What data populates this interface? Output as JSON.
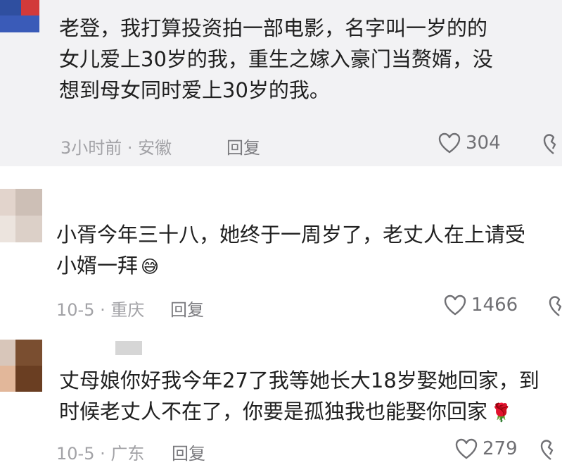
{
  "comments": [
    {
      "lines": [
        "老登，我打算投资拍一部电影，名字叫一岁的的",
        "女儿爱上30岁的我，重生之嫁入豪门当赘婿，没",
        "想到母女同时爱上30岁的我。"
      ],
      "meta": "3小时前 · 安徽",
      "reply_label": "回复",
      "like_count": "304"
    },
    {
      "lines": [
        "小胥今年三十八，她终于一周岁了，老丈人在上请受",
        "小婿一拜"
      ],
      "emoji": "😅",
      "meta": "10-5 · 重庆",
      "reply_label": "回复",
      "like_count": "1466"
    },
    {
      "lines": [
        "丈母娘你好我今年27了我等她长大18岁娶她回家，到",
        "时候老丈人不在了，你要是孤独我也能娶你回家"
      ],
      "emoji": "🌹",
      "meta": "10-5 · 广东",
      "reply_label": "回复",
      "like_count": "279"
    }
  ],
  "colors": {
    "highlight_bg": "#f2f2f4",
    "text": "#202020",
    "meta": "#a2a2a6",
    "icon": "#707074"
  },
  "icons": {
    "like": "heart-outline-icon",
    "dislike": "broken-heart-outline-icon"
  }
}
